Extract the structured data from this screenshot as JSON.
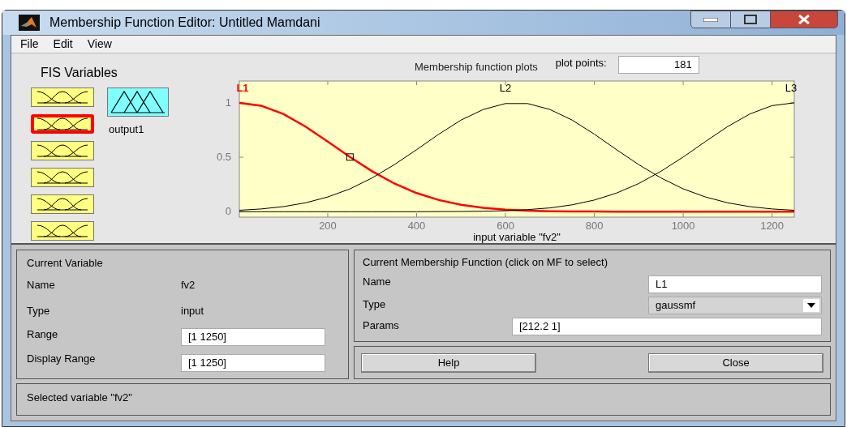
{
  "window": {
    "title": "Membership Function Editor: Untitled Mamdani"
  },
  "menu": [
    "File",
    "Edit",
    "View"
  ],
  "fis_variables": {
    "title": "FIS Variables",
    "inputs": [
      {
        "selected": false
      },
      {
        "selected": true
      },
      {
        "selected": false
      },
      {
        "selected": false
      },
      {
        "selected": false
      },
      {
        "selected": false
      }
    ],
    "outputs": [
      {
        "label": "output1",
        "selected": false
      }
    ]
  },
  "plot_header": {
    "title": "Membership function plots",
    "plot_points_label": "plot points:",
    "plot_points": "181"
  },
  "chart_data": {
    "type": "line",
    "xlabel": "input variable \"fv2\"",
    "xlim": [
      1,
      1250
    ],
    "ylim": [
      -0.05,
      1.2
    ],
    "xticks": [
      200,
      400,
      600,
      800,
      1000,
      1200
    ],
    "yticks": [
      0,
      0.5,
      1
    ],
    "x": [
      1,
      50,
      100,
      150,
      200,
      250,
      300,
      350,
      400,
      450,
      500,
      550,
      600,
      650,
      700,
      750,
      800,
      850,
      900,
      950,
      1000,
      1050,
      1100,
      1150,
      1200,
      1250
    ],
    "series": [
      {
        "name": "L1",
        "color": "#ff0000",
        "values": [
          1,
          0.974,
          0.897,
          0.782,
          0.644,
          0.502,
          0.371,
          0.259,
          0.171,
          0.107,
          0.063,
          0.035,
          0.019,
          0.009,
          0.004,
          0.002,
          0.001,
          0,
          0,
          0,
          0,
          0,
          0,
          0,
          0,
          0
        ]
      },
      {
        "name": "L2",
        "color": "#000000",
        "values": [
          0.013,
          0.025,
          0.047,
          0.082,
          0.135,
          0.21,
          0.31,
          0.432,
          0.57,
          0.712,
          0.841,
          0.939,
          0.993,
          0.993,
          0.939,
          0.841,
          0.712,
          0.57,
          0.432,
          0.31,
          0.21,
          0.135,
          0.082,
          0.047,
          0.025,
          0.013
        ]
      },
      {
        "name": "L3",
        "color": "#000000",
        "values": [
          0,
          0,
          0,
          0,
          0,
          0,
          0,
          0,
          0,
          0.001,
          0.002,
          0.004,
          0.009,
          0.019,
          0.035,
          0.063,
          0.107,
          0.171,
          0.259,
          0.371,
          0.502,
          0.644,
          0.782,
          0.897,
          0.974,
          1
        ]
      }
    ]
  },
  "mf_curves": [
    {
      "selected": true
    },
    {
      "selected": false
    },
    {
      "selected": false
    }
  ],
  "current_variable": {
    "title": "Current Variable",
    "name_label": "Name",
    "name": "fv2",
    "type_label": "Type",
    "type": "input",
    "range_label": "Range",
    "range": "[1 1250]",
    "display_range_label": "Display Range",
    "display_range": "[1 1250]"
  },
  "current_mf": {
    "title": "Current Membership Function (click on MF to select)",
    "name_label": "Name",
    "name": "L1",
    "type_label": "Type",
    "type": "gaussmf",
    "params_label": "Params",
    "params": "[212.2 1]"
  },
  "buttons": [
    "Help",
    "Close"
  ],
  "status": "Selected variable \"fv2\""
}
